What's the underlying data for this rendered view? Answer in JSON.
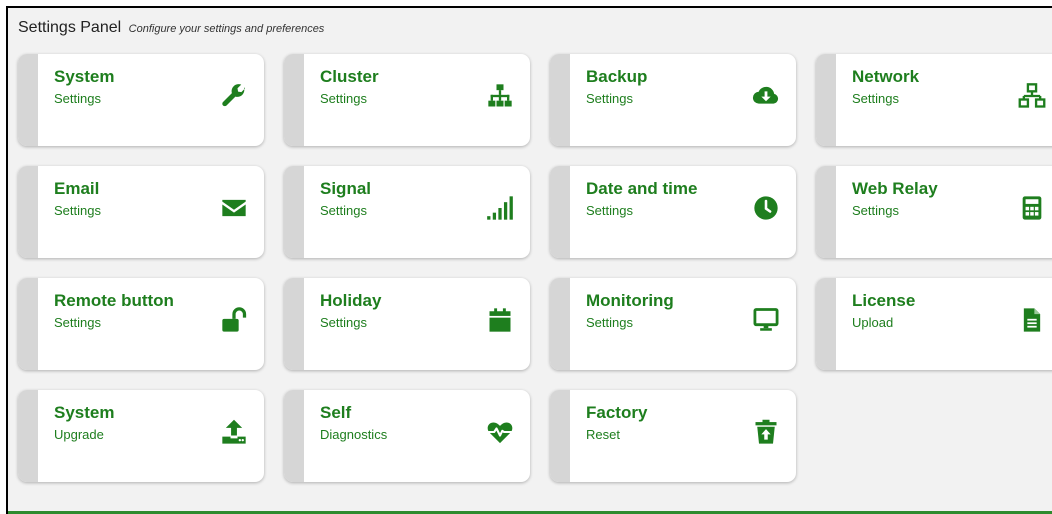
{
  "header": {
    "title": "Settings Panel",
    "subtitle": "Configure your settings and preferences"
  },
  "accent_color": "#1e7e1e",
  "cards": [
    {
      "name": "System",
      "sub": "Settings",
      "icon": "wrench-icon"
    },
    {
      "name": "Cluster",
      "sub": "Settings",
      "icon": "sitemap-icon"
    },
    {
      "name": "Backup",
      "sub": "Settings",
      "icon": "cloud-download-icon"
    },
    {
      "name": "Network",
      "sub": "Settings",
      "icon": "network-icon"
    },
    {
      "name": "Email",
      "sub": "Settings",
      "icon": "envelope-icon"
    },
    {
      "name": "Signal",
      "sub": "Settings",
      "icon": "signal-bars-icon"
    },
    {
      "name": "Date and time",
      "sub": "Settings",
      "icon": "clock-icon"
    },
    {
      "name": "Web Relay",
      "sub": "Settings",
      "icon": "calculator-icon"
    },
    {
      "name": "Remote button",
      "sub": "Settings",
      "icon": "unlock-icon"
    },
    {
      "name": "Holiday",
      "sub": "Settings",
      "icon": "calendar-icon"
    },
    {
      "name": "Monitoring",
      "sub": "Settings",
      "icon": "monitor-icon"
    },
    {
      "name": "License",
      "sub": "Upload",
      "icon": "file-text-icon"
    },
    {
      "name": "System",
      "sub": "Upgrade",
      "icon": "upload-icon"
    },
    {
      "name": "Self",
      "sub": "Diagnostics",
      "icon": "heartbeat-icon"
    },
    {
      "name": "Factory",
      "sub": "Reset",
      "icon": "trash-restore-icon"
    }
  ]
}
